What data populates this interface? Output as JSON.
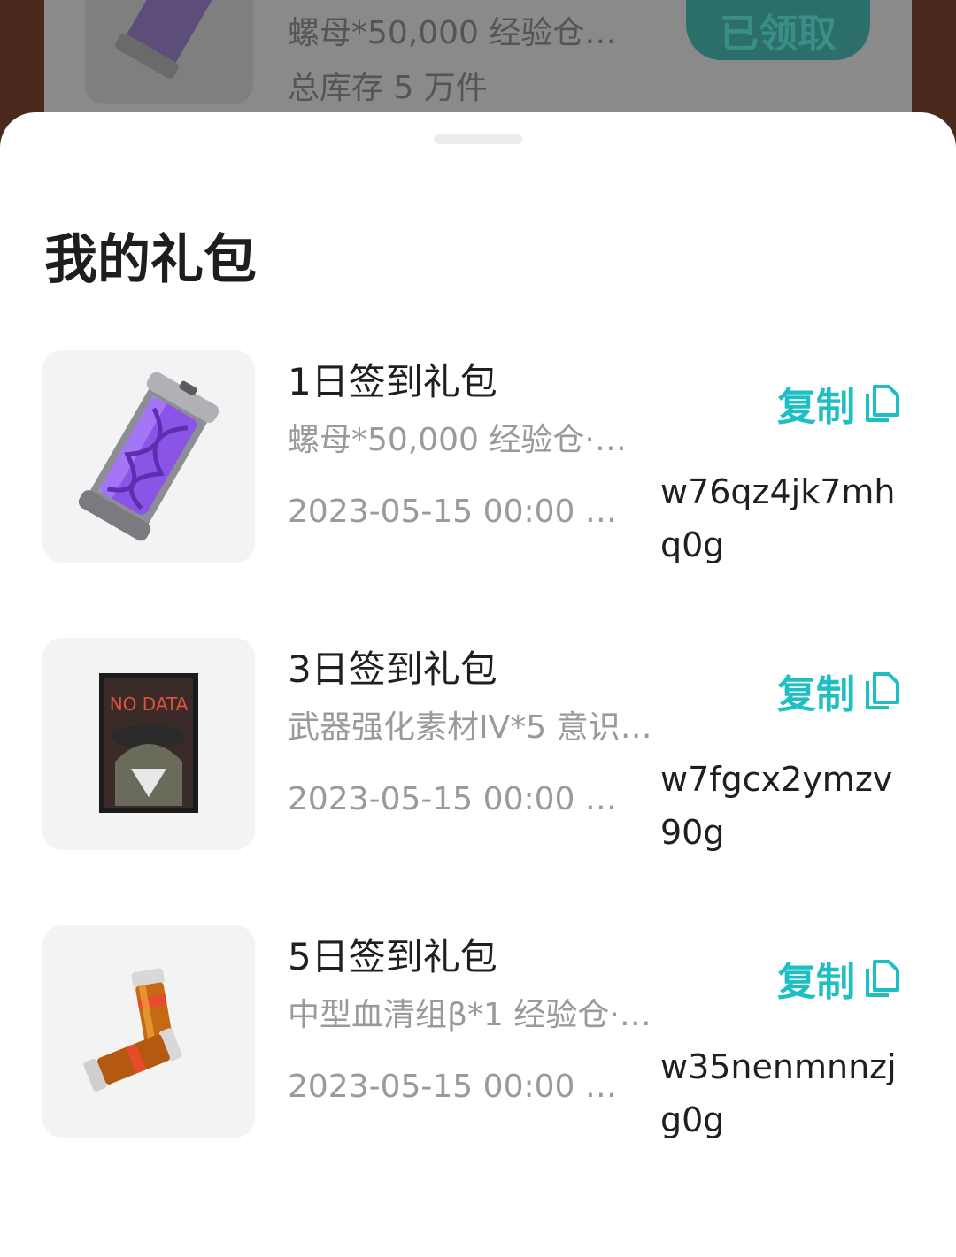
{
  "background_card": {
    "desc": "螺母*50,000 经验仓…",
    "stock": "总库存 5 万件",
    "button": "已领取"
  },
  "sheet": {
    "title": "我的礼包"
  },
  "gifts": [
    {
      "name": "1日签到礼包",
      "desc": "螺母*50,000 经验仓·…",
      "date": "2023-05-15 00:00 …",
      "code": "w76qz4jk7mhq0g",
      "copy_label": "复制",
      "icon": "exp-capsule-icon"
    },
    {
      "name": "3日签到礼包",
      "desc": "武器强化素材IV*5 意识…",
      "date": "2023-05-15 00:00 …",
      "code": "w7fgcx2ymzv90g",
      "copy_label": "复制",
      "icon": "no-data-card-icon"
    },
    {
      "name": "5日签到礼包",
      "desc": "中型血清组β*1 经验仓·…",
      "date": "2023-05-15 00:00 …",
      "code": "w35nenmnnzjg0g",
      "copy_label": "复制",
      "icon": "serum-vials-icon"
    }
  ],
  "colors": {
    "accent": "#1dbfc3",
    "backdrop": "#4a2a1c"
  }
}
